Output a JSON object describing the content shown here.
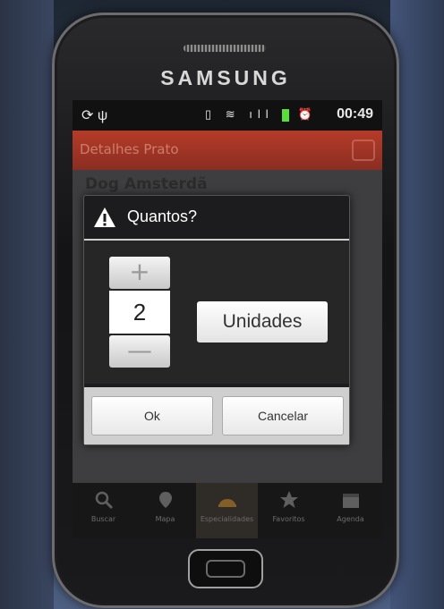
{
  "device": {
    "brand": "SAMSUNG"
  },
  "status_bar": {
    "time": "00:49"
  },
  "app_bar": {
    "title": "Detalhes Prato"
  },
  "content": {
    "item_title": "Dog Amsterdã"
  },
  "dialog": {
    "title": "Quantos?",
    "picker": {
      "plus": "+",
      "value": "2",
      "minus": "—"
    },
    "unit_label": "Unidades",
    "ok_label": "Ok",
    "cancel_label": "Cancelar"
  },
  "tabs": [
    {
      "label": "Buscar",
      "icon": "search-icon"
    },
    {
      "label": "Mapa",
      "icon": "map-pin-icon"
    },
    {
      "label": "Especialidades",
      "icon": "specialties-icon"
    },
    {
      "label": "Favoritos",
      "icon": "star-icon"
    },
    {
      "label": "Agenda",
      "icon": "calendar-icon"
    }
  ]
}
